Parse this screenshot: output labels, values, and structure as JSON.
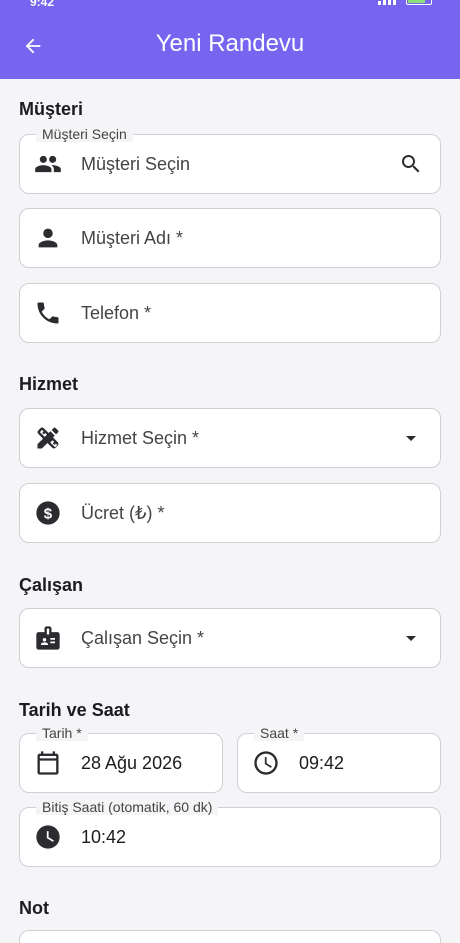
{
  "status": {
    "time": "9:42",
    "battery": "99"
  },
  "header": {
    "title": "Yeni Randevu"
  },
  "sections": {
    "musteri": "Müşteri",
    "hizmet": "Hizmet",
    "calisan": "Çalışan",
    "tarih_saat": "Tarih ve Saat",
    "not": "Not"
  },
  "fields": {
    "musteri_secin": {
      "label": "Müşteri Seçin",
      "placeholder": "Müşteri Seçin"
    },
    "musteri_adi": {
      "placeholder": "Müşteri Adı *"
    },
    "telefon": {
      "placeholder": "Telefon *"
    },
    "hizmet_secin": {
      "placeholder": "Hizmet Seçin *"
    },
    "ucret": {
      "placeholder": "Ücret (₺) *"
    },
    "calisan_secin": {
      "placeholder": "Çalışan Seçin *"
    },
    "tarih": {
      "label": "Tarih *",
      "value": "28 Ağu 2026"
    },
    "saat": {
      "label": "Saat *",
      "value": "09:42"
    },
    "bitis_saati": {
      "label": "Bitiş Saati (otomatik, 60 dk)",
      "value": "10:42"
    }
  },
  "colors": {
    "accent": "#7765f0",
    "background": "#f5f5f7",
    "icon": "#2b2b30"
  }
}
